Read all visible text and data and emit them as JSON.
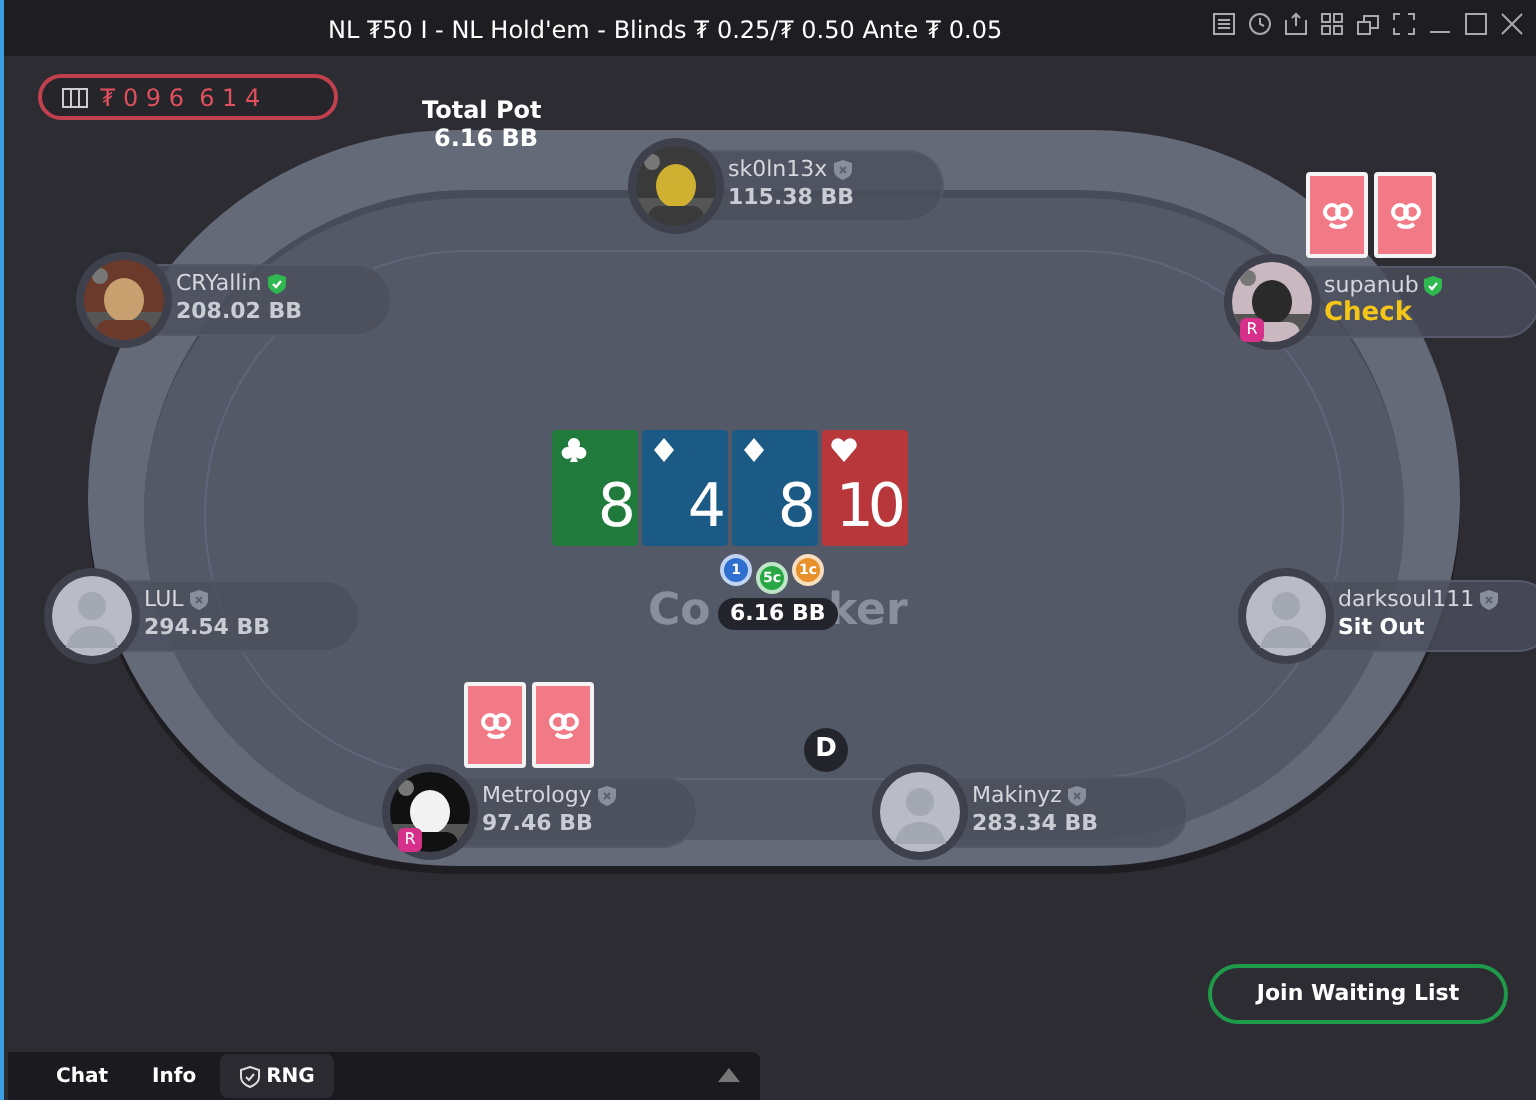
{
  "window": {
    "title": "NL ₮50 I - NL Hold'em - Blinds ₮ 0.25/₮ 0.50 Ante ₮ 0.05"
  },
  "jackpot": {
    "value": "₮ 0 9 6  6 1 4"
  },
  "total_pot": {
    "label": "Total Pot",
    "value": "6.16 BB"
  },
  "table_logo": [
    "Co",
    "ker"
  ],
  "seats": [
    {
      "name": "sk0ln13x",
      "line2": "115.38 BB",
      "kind": "stack",
      "verified": false,
      "has_cards": false
    },
    {
      "name": "CRYallin",
      "line2": "208.02 BB",
      "kind": "stack",
      "verified": true,
      "has_cards": false
    },
    {
      "name": "supanub",
      "line2": "Check",
      "kind": "action",
      "verified": true,
      "badge": "R",
      "has_cards": true
    },
    {
      "name": "LUL",
      "line2": "294.54 BB",
      "kind": "stack",
      "verified": false,
      "avatar": {
        "kind": "silhouette"
      },
      "has_cards": false
    },
    {
      "name": "darksoul111",
      "line2": "Sit Out",
      "kind": "sitting_out",
      "verified": false,
      "avatar": {
        "kind": "silhouette"
      },
      "has_cards": false
    },
    {
      "name": "Metrology",
      "line2": "97.46 BB",
      "kind": "stack",
      "verified": false,
      "badge": "R",
      "has_cards": true
    },
    {
      "name": "Makinyz",
      "line2": "283.34 BB",
      "kind": "stack",
      "verified": false,
      "avatar": {
        "kind": "silhouette"
      },
      "has_cards": false
    }
  ],
  "board": [
    {
      "rank": "8",
      "kind": "clubs"
    },
    {
      "rank": "4",
      "kind": "diamonds"
    },
    {
      "rank": "8",
      "kind": "diamonds"
    },
    {
      "rank": "10",
      "kind": "hearts"
    }
  ],
  "pot_chips": [
    {
      "label": "1",
      "color": "#2f6fd0"
    },
    {
      "label": "5c",
      "color": "#27a845"
    },
    {
      "label": "1c",
      "color": "#e8912a"
    }
  ],
  "pot": "6.16 BB",
  "dealer_button": "D",
  "join_button": "Join Waiting List",
  "bottom_tabs": [
    {
      "label": "Chat",
      "selected": false,
      "icon": false
    },
    {
      "label": "Info",
      "selected": false,
      "icon": false
    },
    {
      "label": "RNG",
      "selected": true,
      "icon": true
    }
  ]
}
